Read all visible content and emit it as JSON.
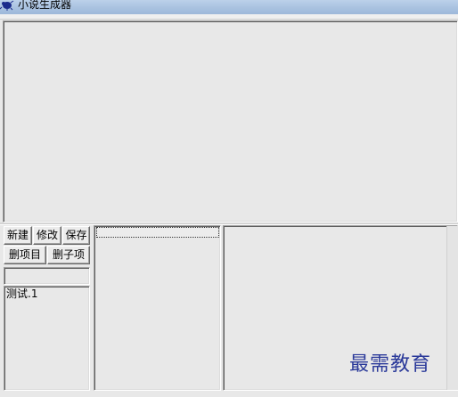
{
  "window": {
    "title": "小说生成器"
  },
  "toolbar": {
    "new_label": "新建",
    "edit_label": "修改",
    "save_label": "保存",
    "delete_item_label": "删项目",
    "delete_child_label": "删子项"
  },
  "name_field": {
    "value": ""
  },
  "item_list": {
    "items": [
      "测试.1"
    ]
  },
  "watermark": {
    "text": "最需教育"
  },
  "colors": {
    "titlebar": "#a9c2e0",
    "window_bg": "#e8e8e8",
    "watermark": "#2b3a9a"
  },
  "icons": {
    "app": "bug-icon"
  }
}
